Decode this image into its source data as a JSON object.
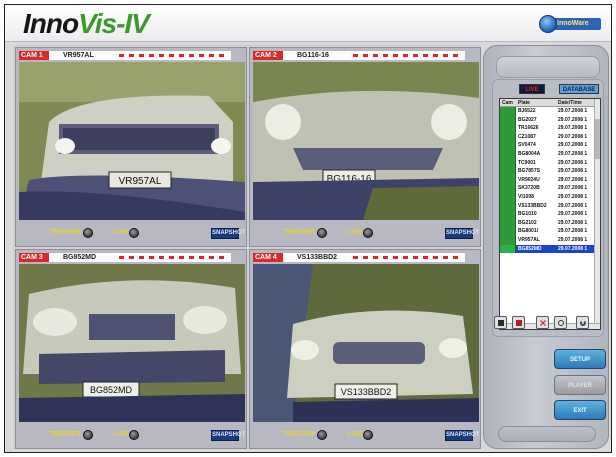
{
  "app": {
    "logo_part1": "Inno",
    "logo_part2": "Vis-IV",
    "brand": "InnoWare"
  },
  "cameras": [
    {
      "id": "CAM 1",
      "plate": "VR957AL",
      "trigger_label": "TRIGGER",
      "live_label": "LIVE",
      "snap_label": "SNAPSHOT"
    },
    {
      "id": "CAM 2",
      "plate": "BG116-16",
      "trigger_label": "TRIGGER",
      "live_label": "LIVE",
      "snap_label": "SNAPSHOT"
    },
    {
      "id": "CAM 3",
      "plate": "BG852MD",
      "trigger_label": "TRIGGER",
      "live_label": "LIVE",
      "snap_label": "SNAPSHOT"
    },
    {
      "id": "CAM 4",
      "plate": "VS133BBD2",
      "trigger_label": "TRIGGER",
      "live_label": "LIVE",
      "snap_label": "SNAPSHOT"
    }
  ],
  "panel": {
    "tab_live": "LIVE",
    "tab_database": "DATABASE",
    "table": {
      "columns": [
        "Cam",
        "Plate",
        "Date/Time"
      ],
      "rows": [
        {
          "plate": "BJ6522",
          "datetime": "29.07.2008 1"
        },
        {
          "plate": "BG2027",
          "datetime": "29.07.2008 1"
        },
        {
          "plate": "TR16626",
          "datetime": "29.07.2008 1"
        },
        {
          "plate": "CZ1087",
          "datetime": "29.07.2008 1"
        },
        {
          "plate": "SV0474",
          "datetime": "29.07.2008 1"
        },
        {
          "plate": "BG8004A",
          "datetime": "29.07.2008 1"
        },
        {
          "plate": "TC9001",
          "datetime": "29.07.2008 1"
        },
        {
          "plate": "BG7857S",
          "datetime": "29.07.2008 1"
        },
        {
          "plate": "VR9024U",
          "datetime": "29.07.2008 1"
        },
        {
          "plate": "SK3720B",
          "datetime": "29.07.2008 1"
        },
        {
          "plate": "VI1098",
          "datetime": "29.07.2008 1"
        },
        {
          "plate": "VS133BBD2",
          "datetime": "29.07.2008 1"
        },
        {
          "plate": "BG1010",
          "datetime": "29.07.2008 1"
        },
        {
          "plate": "BG2102",
          "datetime": "29.07.2008 1"
        },
        {
          "plate": "BG8001I",
          "datetime": "29.07.2008 1"
        },
        {
          "plate": "VR957AL",
          "datetime": "29.07.2008 1"
        },
        {
          "plate": "BG852MD",
          "datetime": "29.07.2008 1",
          "selected": true
        }
      ]
    },
    "buttons": {
      "setup": "SETUP",
      "player": "PLAYER",
      "exit": "EXIT"
    }
  },
  "icons": [
    "camera-icon",
    "record-icon",
    "delete-icon",
    "search-icon",
    "refresh-icon"
  ],
  "colors": {
    "accent": "#3c9a2c",
    "cam_label": "#d82a2a",
    "selection": "#1e44c8",
    "button": "#2c7ab7"
  }
}
